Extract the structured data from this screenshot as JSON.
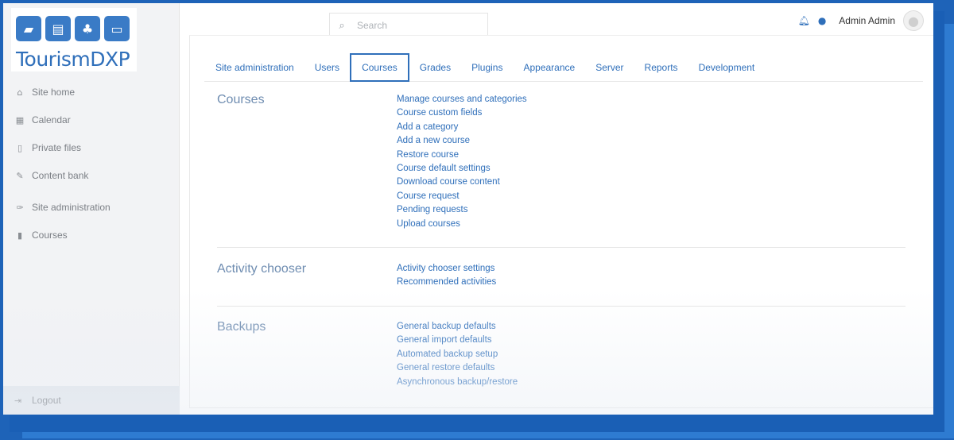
{
  "logo": {
    "icons": [
      "bus-icon",
      "building-icon",
      "palm-tree-icon",
      "bed-icon"
    ],
    "text": "TourismDXP"
  },
  "sidebar": {
    "items": [
      {
        "label": "Site home",
        "icon": "home-icon"
      },
      {
        "label": "Calendar",
        "icon": "calendar-icon"
      },
      {
        "label": "Private files",
        "icon": "file-icon"
      },
      {
        "label": "Content bank",
        "icon": "paintbrush-icon"
      },
      {
        "label": "Site administration",
        "icon": "wrench-icon"
      },
      {
        "label": "Courses",
        "icon": "archive-icon"
      }
    ],
    "logout": {
      "label": "Logout",
      "icon": "sign-out-icon"
    }
  },
  "header": {
    "search_placeholder": "Search",
    "user_name": "Admin Admin"
  },
  "tabs": [
    {
      "label": "Site administration",
      "active": false
    },
    {
      "label": "Users",
      "active": false
    },
    {
      "label": "Courses",
      "active": true
    },
    {
      "label": "Grades",
      "active": false
    },
    {
      "label": "Plugins",
      "active": false
    },
    {
      "label": "Appearance",
      "active": false
    },
    {
      "label": "Server",
      "active": false
    },
    {
      "label": "Reports",
      "active": false
    },
    {
      "label": "Development",
      "active": false
    }
  ],
  "sections": [
    {
      "title": "Courses",
      "links": [
        "Manage courses and categories",
        "Course custom fields",
        "Add a category",
        "Add a new course",
        "Restore course",
        "Course default settings",
        "Download course content",
        "Course request",
        "Pending requests",
        "Upload courses"
      ]
    },
    {
      "title": "Activity chooser",
      "links": [
        "Activity chooser settings",
        "Recommended activities"
      ]
    },
    {
      "title": "Backups",
      "links": [
        "General backup defaults",
        "General import defaults",
        "Automated backup setup",
        "General restore defaults",
        "Asynchronous backup/restore"
      ]
    }
  ],
  "colors": {
    "accent": "#2f6fba",
    "frame": "#1e63b8",
    "section_title": "#6f8db1"
  }
}
